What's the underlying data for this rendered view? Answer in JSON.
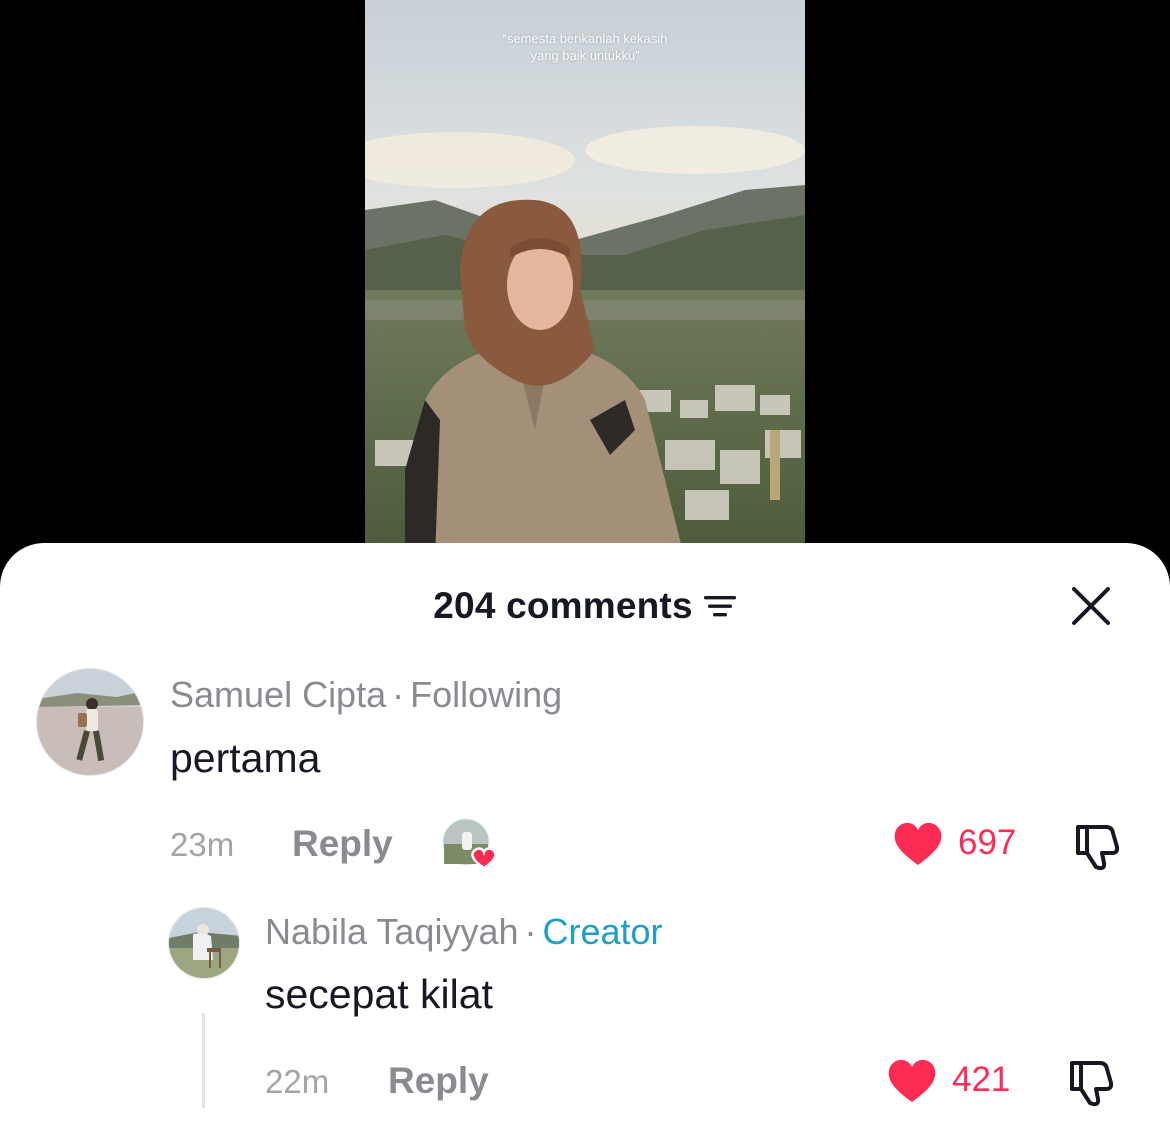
{
  "video": {
    "caption_line1": "“semesta berikanlah kekasih",
    "caption_line2": "yang baik untukku”"
  },
  "sheet": {
    "title": "204 comments",
    "filter_icon": "filter-icon",
    "close_icon": "close-icon"
  },
  "comments": [
    {
      "author": "Samuel Cipta",
      "separator": "·",
      "relation": "Following",
      "text": "pertama",
      "time": "23m",
      "reply_label": "Reply",
      "likes": "697",
      "creator_liked": true
    },
    {
      "author": "Nabila Taqiyyah",
      "separator": "·",
      "relation": "Creator",
      "text": "secepat kilat",
      "time": "22m",
      "reply_label": "Reply",
      "likes": "421"
    }
  ],
  "colors": {
    "like": "#fe2c55",
    "creator_badge": "#1ca0c8",
    "secondary_text": "#8a8b91"
  }
}
